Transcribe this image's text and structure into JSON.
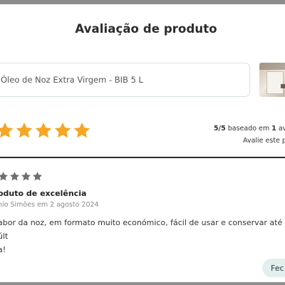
{
  "modal": {
    "title": "Avaliação de produto",
    "product": {
      "name": "Óleo de Noz Extra Virgem - BIB 5 L"
    },
    "summary": {
      "rating_score": "5/5",
      "based_on_text": " baseado em ",
      "review_count": "1",
      "reviews_word": " aval",
      "rate_link": "Avalie este pr",
      "star_count": 5,
      "star_color": "#f5a623"
    },
    "review": {
      "stars": 4,
      "star_color": "#6e6e6e",
      "title": "oduto de excelência",
      "meta": "nio Simões em 2 agosto 2024",
      "text_line1": "abor da noz, em formato muito económico, fácil de usar e conservar até à últ",
      "text_line2": "a!"
    },
    "close_button": "Fec"
  }
}
